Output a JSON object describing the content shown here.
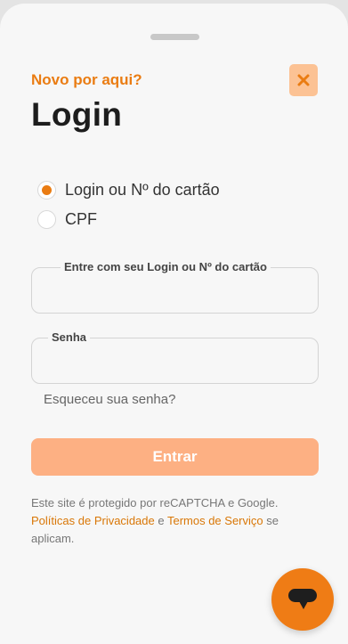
{
  "modal": {
    "kicker": "Novo por aqui?",
    "title": "Login",
    "close_icon": "close-icon"
  },
  "login_type": {
    "options": [
      {
        "label": "Login ou Nº do cartão",
        "selected": true
      },
      {
        "label": "CPF",
        "selected": false
      }
    ]
  },
  "fields": {
    "login_label": "Entre com seu Login ou Nº do cartão",
    "login_value": "",
    "password_label": "Senha",
    "password_value": ""
  },
  "links": {
    "forgot_password": "Esqueceu sua senha?"
  },
  "submit": {
    "label": "Entrar"
  },
  "legal": {
    "text1": "Este site é protegido por reCAPTCHA e Google.",
    "privacy_link": "Políticas de Privacidade",
    "conjunction": " e ",
    "terms_link": "Termos de Serviço",
    "text2": " se aplicam."
  },
  "chat": {
    "icon": "chat-bubble-icon"
  },
  "colors": {
    "accent": "#ea7c12",
    "button_disabled": "#fdb083",
    "close_bg": "#fcc294"
  }
}
